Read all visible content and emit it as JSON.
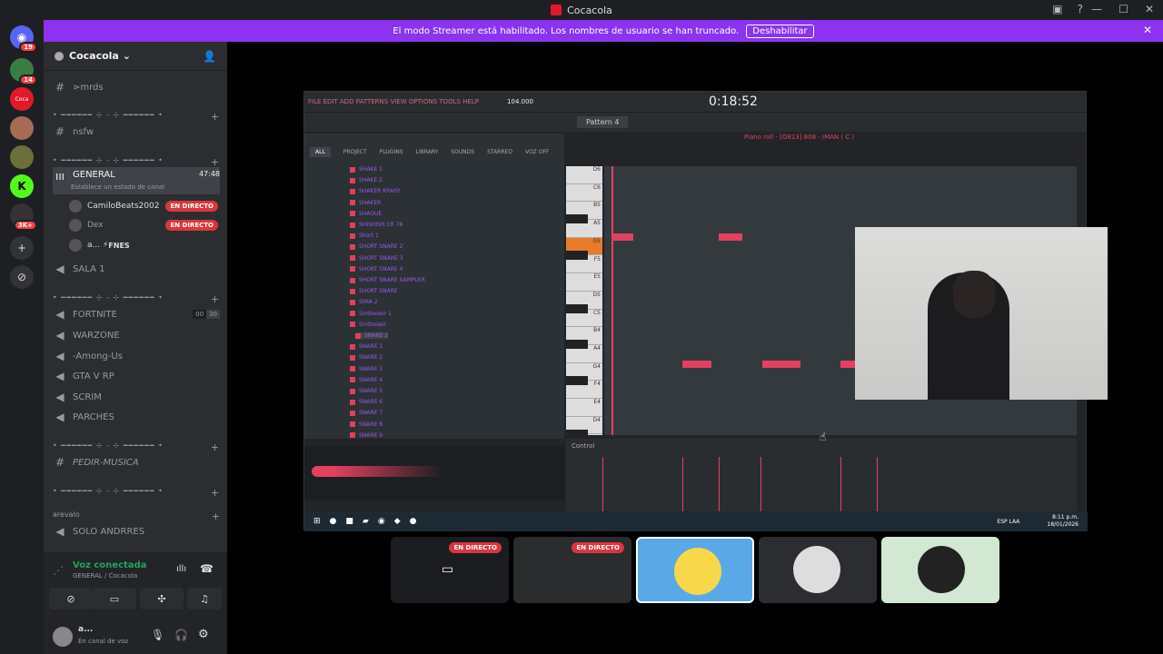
{
  "window": {
    "title": "Cocacola"
  },
  "banner": {
    "text": "El modo Streamer está habilitado. Los nombres de usuario se han truncado.",
    "button": "Deshabilitar"
  },
  "servers": [
    {
      "badge": "19"
    },
    {
      "badge": "14"
    },
    {
      "badge": ""
    },
    {
      "badge": ""
    },
    {
      "badge": ""
    },
    {
      "badge": ""
    },
    {
      "badge": "3K+"
    }
  ],
  "server": {
    "name": "Cocacola"
  },
  "channels": {
    "mrds": "⋗mrds",
    "sep": "• ━━━━━━ ⊹ - ⊹ ━━━━━━ •",
    "nsfw": "nsfw",
    "general": "GENERAL",
    "general_time": "47:48",
    "general_status": "Establece un estado de canal",
    "users": [
      {
        "name": "CamiloBeats2002",
        "live": "EN DIRECTO"
      },
      {
        "name": "Dex",
        "live": "EN DIRECTO"
      },
      {
        "name": "a...",
        "tag": "FNES"
      }
    ],
    "sala": "SALA 1",
    "fortnite": "FORTNITE",
    "fortnite_c1": "00",
    "fortnite_c2": "30",
    "warzone": "WARZONE",
    "among": "-Among-Us",
    "gta": "GTA V RP",
    "scrim": "SCRIM",
    "parches": "PARCHES",
    "pedir": "PEDIR-MUSICA",
    "cat_arevalo": "arevalo",
    "solo": "SOLO ANDRRES"
  },
  "voice": {
    "status": "Voz conectada",
    "location": "GENERAL / Cocacola"
  },
  "me": {
    "name": "a...",
    "status": "En canal de voz"
  },
  "fl": {
    "menu": "FILE EDIT ADD PATTERNS VIEW OPTIONS TOOLS HELP",
    "time": "0:18:52",
    "tempo": "104.000",
    "pattern": "Pattern 4",
    "pianoroll": "Piano roll - [O813] 808 - IMAN ( C )",
    "tabs": [
      "ALL",
      "PROJECT",
      "PLUGINS",
      "LIBRARY",
      "SOUNDS",
      "STARRED",
      "VOZ OFF"
    ],
    "items": [
      "SHAKE 1",
      "SHAKE 2",
      "SHAKER KRASY",
      "SHAKER",
      "SHAOUE",
      "SHISHISH CR 76",
      "Short 1",
      "SHORT SNARE 2",
      "SHORT SNARE 3",
      "SHORT SNARE 4",
      "SHORT SNARE SAMPLER",
      "SHORT SNARE",
      "SIMA 2",
      "Sintheiser 1",
      "Sintheiser",
      "SNARE 2",
      "SNARE 1",
      "SNARE 2",
      "SNARE 3",
      "SNARE 4",
      "SNARE 5",
      "SNARE 6",
      "SNARE 7",
      "SNARE 8",
      "SNARE 9"
    ],
    "keys": [
      "D6",
      "C6",
      "B5",
      "A5",
      "G5",
      "F5",
      "E5",
      "D5",
      "C5",
      "B4",
      "A4",
      "G4",
      "F4",
      "E4",
      "D4"
    ],
    "control": "Control",
    "tray": "ESP LAA",
    "clock_time": "8:11 p.m.",
    "clock_date": "18/01/2026"
  },
  "tiles": [
    {
      "live": "EN DIRECTO"
    },
    {
      "live": "EN DIRECTO"
    },
    {
      "live": ""
    },
    {
      "live": ""
    },
    {
      "live": ""
    }
  ]
}
